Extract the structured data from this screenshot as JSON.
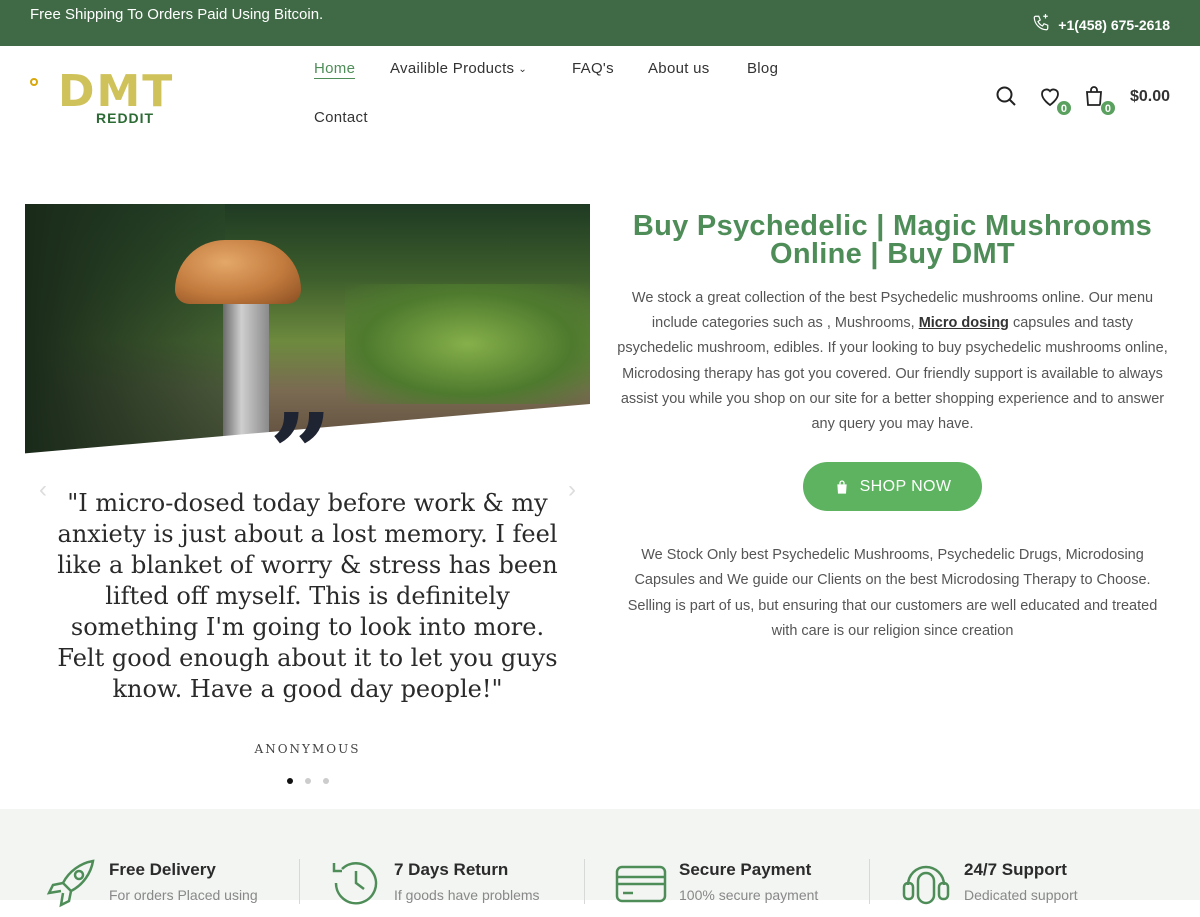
{
  "topbar": {
    "promo": "Free Shipping To Orders Paid Using Bitcoin.",
    "phone": "+1(458) 675-2618"
  },
  "logo": {
    "primary": "DMT",
    "secondary": "REDDIT"
  },
  "nav": {
    "items": [
      {
        "label": "Home"
      },
      {
        "label": "Availible Products"
      },
      {
        "label": "FAQ's"
      },
      {
        "label": "About us"
      },
      {
        "label": "Blog"
      },
      {
        "label": "Contact"
      }
    ]
  },
  "header": {
    "wishlist_count": "0",
    "cart_count": "0",
    "cart_total": "$0.00"
  },
  "testimonial": {
    "quote_mark": "”",
    "text": "\"I micro-dosed today before work & my anxiety is just about a lost memory. I feel like a blanket of worry & stress has been lifted off myself. This is definitely something I'm going to look into more. Felt good enough about it to let you guys know. Have a good day people!\"",
    "author": "ANONYMOUS",
    "prev_arrow": "‹",
    "next_arrow": "›"
  },
  "intro": {
    "title": "Buy Psychedelic | Magic Mushrooms Online | Buy DMT",
    "para1_before": "We stock a great collection of the best Psychedelic mushrooms online. Our menu include categories such as , Mushrooms, ",
    "para1_link": "Micro dosing",
    "para1_after": " capsules and tasty psychedelic mushroom, edibles. If your looking to buy psychedelic mushrooms online, Microdosing therapy has got you covered. Our friendly support is available to always assist you while you shop on our site for a better shopping experience and to answer any query you may have.",
    "button": "SHOP NOW",
    "para2": "We Stock Only best Psychedelic Mushrooms, Psychedelic Drugs, Microdosing Capsules and We guide our Clients on the best Microdosing  Therapy to Choose. Selling is part of us, but ensuring that our customers are well educated and treated with care is our religion since creation"
  },
  "features": [
    {
      "title": "Free Delivery",
      "desc": "For orders Placed using",
      "icon": "rocket-icon"
    },
    {
      "title": "7 Days Return",
      "desc": "If goods have problems",
      "icon": "history-icon"
    },
    {
      "title": "Secure Payment",
      "desc": "100% secure payment",
      "icon": "credit-card-icon"
    },
    {
      "title": "24/7 Support",
      "desc": "Dedicated support",
      "icon": "headset-icon"
    }
  ],
  "colors": {
    "topbar": "#3f6a45",
    "accent": "#4e8d58",
    "button": "#5db35f"
  }
}
